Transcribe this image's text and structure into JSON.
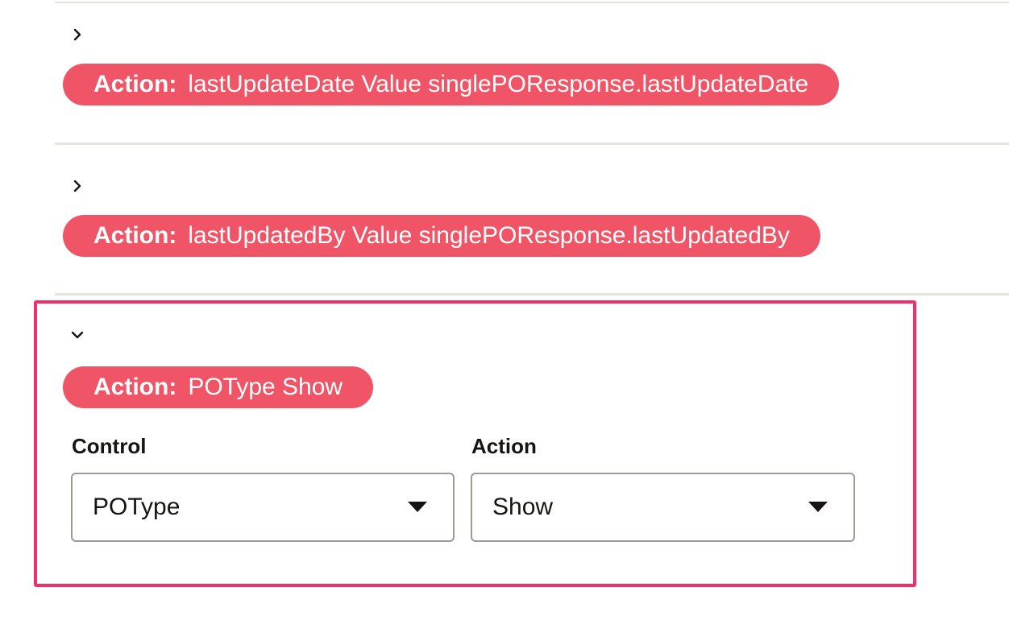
{
  "rules": [
    {
      "expanded": false,
      "toggle_icon": "chevron-right-icon",
      "action_prefix": "Action:",
      "action_text": "lastUpdateDate Value singlePOResponse.lastUpdateDate"
    },
    {
      "expanded": false,
      "toggle_icon": "chevron-right-icon",
      "action_prefix": "Action:",
      "action_text": "lastUpdatedBy Value singlePOResponse.lastUpdatedBy"
    },
    {
      "expanded": true,
      "toggle_icon": "chevron-down-icon",
      "action_prefix": "Action:",
      "action_text": "POType Show",
      "control_label": "Control",
      "control_value": "POType",
      "action_label": "Action",
      "action_value": "Show"
    }
  ],
  "colors": {
    "pill": "#ef5566",
    "highlight": "#f0306d",
    "divider": "#e4e1dd"
  }
}
